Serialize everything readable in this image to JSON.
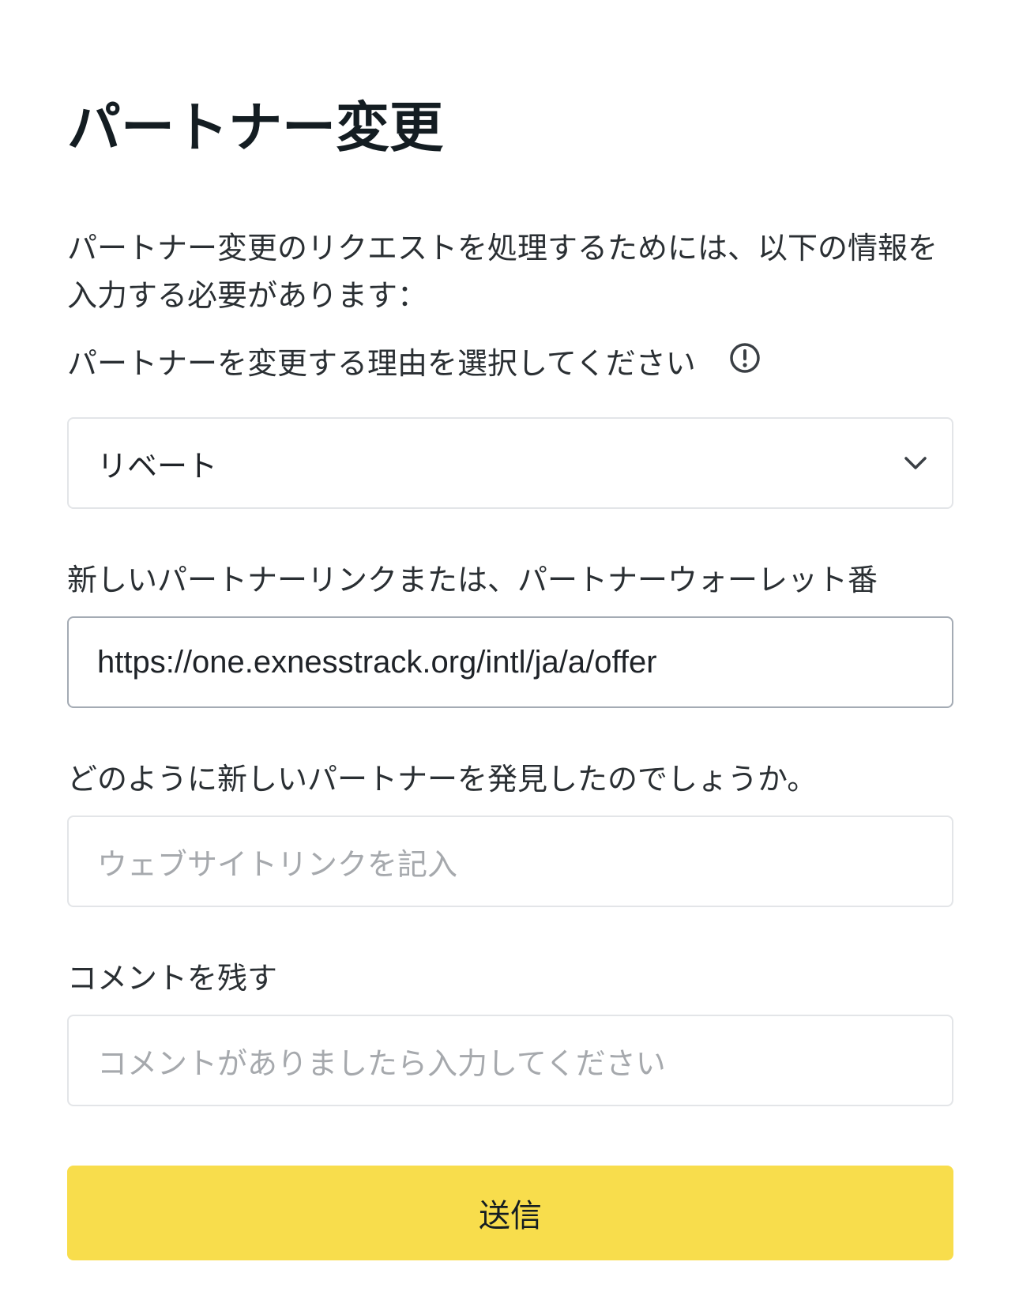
{
  "page": {
    "title": "パートナー変更",
    "intro": "パートナー変更のリクエストを処理するためには、以下の情報を入力する必要があります："
  },
  "form": {
    "reason": {
      "label": "パートナーを変更する理由を選択してください",
      "info_icon": "info-circle-icon",
      "value": "リベート",
      "dropdown_icon": "chevron-down-icon"
    },
    "partner_link": {
      "label": "新しいパートナーリンクまたは、パートナーウォーレット番",
      "value": "https://one.exnesstrack.org/intl/ja/a/offer"
    },
    "discovery": {
      "label": "どのように新しいパートナーを発見したのでしょうか。",
      "placeholder": "ウェブサイトリンクを記入"
    },
    "comment": {
      "label": "コメントを残す",
      "placeholder": "コメントがありましたら入力してください"
    },
    "submit_label": "送信"
  },
  "colors": {
    "submit_button": "#f8dd4c",
    "text": "#141d22",
    "placeholder": "#a6a9ad",
    "border": "#e3e5e8",
    "focused_border": "#a4abb4"
  }
}
